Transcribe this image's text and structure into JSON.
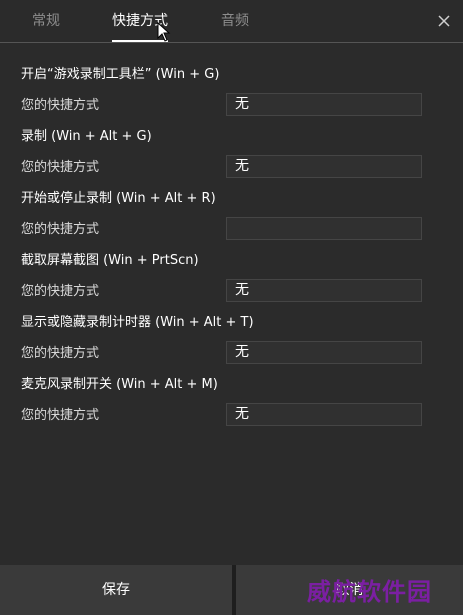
{
  "tabs": [
    {
      "label": "常规",
      "active": false
    },
    {
      "label": "快捷方式",
      "active": true
    },
    {
      "label": "音频",
      "active": false
    }
  ],
  "close_icon": "close-icon",
  "shortcuts": [
    {
      "title": "开启“游戏录制工具栏” (Win + G)",
      "label": "您的快捷方式",
      "value": "无"
    },
    {
      "title": "录制 (Win + Alt + G)",
      "label": "您的快捷方式",
      "value": "无"
    },
    {
      "title": "开始或停止录制 (Win + Alt + R)",
      "label": "您的快捷方式",
      "value": ""
    },
    {
      "title": "截取屏幕截图 (Win + PrtScn)",
      "label": "您的快捷方式",
      "value": "无"
    },
    {
      "title": "显示或隐藏录制计时器 (Win + Alt + T)",
      "label": "您的快捷方式",
      "value": "无"
    },
    {
      "title": "麦克风录制开关 (Win + Alt + M)",
      "label": "您的快捷方式",
      "value": "无"
    }
  ],
  "footer": {
    "save_label": "保存",
    "cancel_label": "取消"
  },
  "watermark": "威航软件园",
  "colors": {
    "background": "#2b2b2b",
    "watermark": "#7b1fa2"
  }
}
